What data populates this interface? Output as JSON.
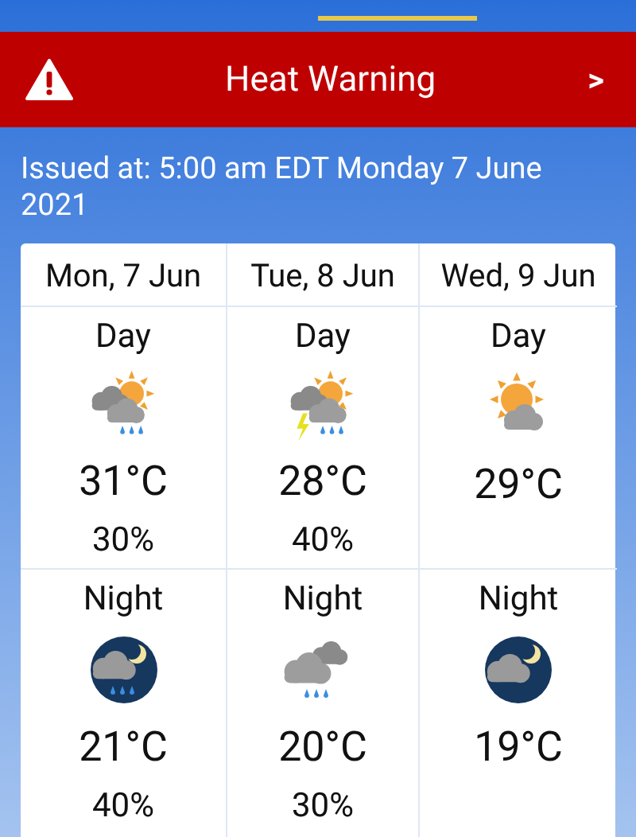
{
  "warning": {
    "title": "Heat Warning",
    "chevron": ">"
  },
  "issued": "Issued at: 5:00 am EDT Monday 7 June 2021",
  "days": [
    {
      "date": "Mon, 7 Jun",
      "periods": [
        {
          "label": "Day",
          "kind": "sun-cloud-rain",
          "temp": "31°C",
          "chance": "30%"
        },
        {
          "label": "Night",
          "kind": "moon-cloud-rain",
          "temp": "21°C",
          "chance": "40%"
        }
      ]
    },
    {
      "date": "Tue, 8 Jun",
      "periods": [
        {
          "label": "Day",
          "kind": "sun-cloud-storm",
          "temp": "28°C",
          "chance": "40%"
        },
        {
          "label": "Night",
          "kind": "cloud-rain",
          "temp": "20°C",
          "chance": "30%"
        }
      ]
    },
    {
      "date": "Wed, 9 Jun",
      "periods": [
        {
          "label": "Day",
          "kind": "sun-cloud",
          "temp": "29°C"
        },
        {
          "label": "Night",
          "kind": "moon-cloud",
          "temp": "19°C"
        }
      ]
    }
  ]
}
